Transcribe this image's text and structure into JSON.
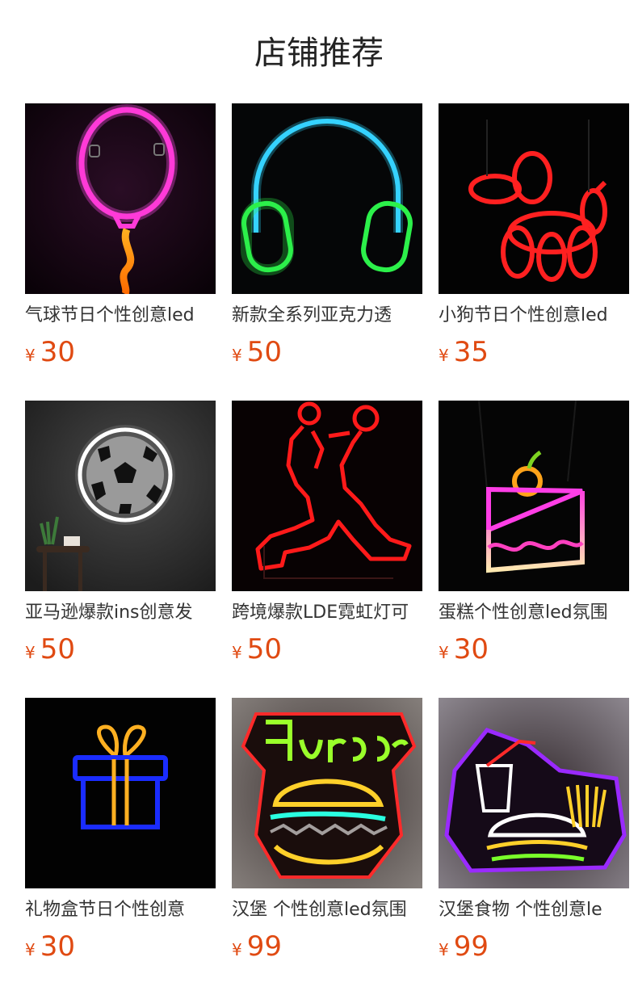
{
  "page_title": "店铺推荐",
  "currency_symbol": "¥",
  "products": [
    {
      "name": "气球节日个性创意led",
      "price": "30",
      "image": "neon-balloon"
    },
    {
      "name": "新款全系列亚克力透",
      "price": "50",
      "image": "neon-headphones"
    },
    {
      "name": "小狗节日个性创意led",
      "price": "35",
      "image": "neon-balloon-dog"
    },
    {
      "name": "亚马逊爆款ins创意发",
      "price": "50",
      "image": "neon-soccer-ball"
    },
    {
      "name": "跨境爆款LDE霓虹灯可",
      "price": "50",
      "image": "neon-basketball-player"
    },
    {
      "name": "蛋糕个性创意led氛围",
      "price": "30",
      "image": "neon-cake-slice"
    },
    {
      "name": "礼物盒节日个性创意",
      "price": "30",
      "image": "neon-gift-box"
    },
    {
      "name": "汉堡 个性创意led氛围",
      "price": "99",
      "image": "neon-burger"
    },
    {
      "name": "汉堡食物 个性创意le",
      "price": "99",
      "image": "neon-burger-meal"
    }
  ]
}
